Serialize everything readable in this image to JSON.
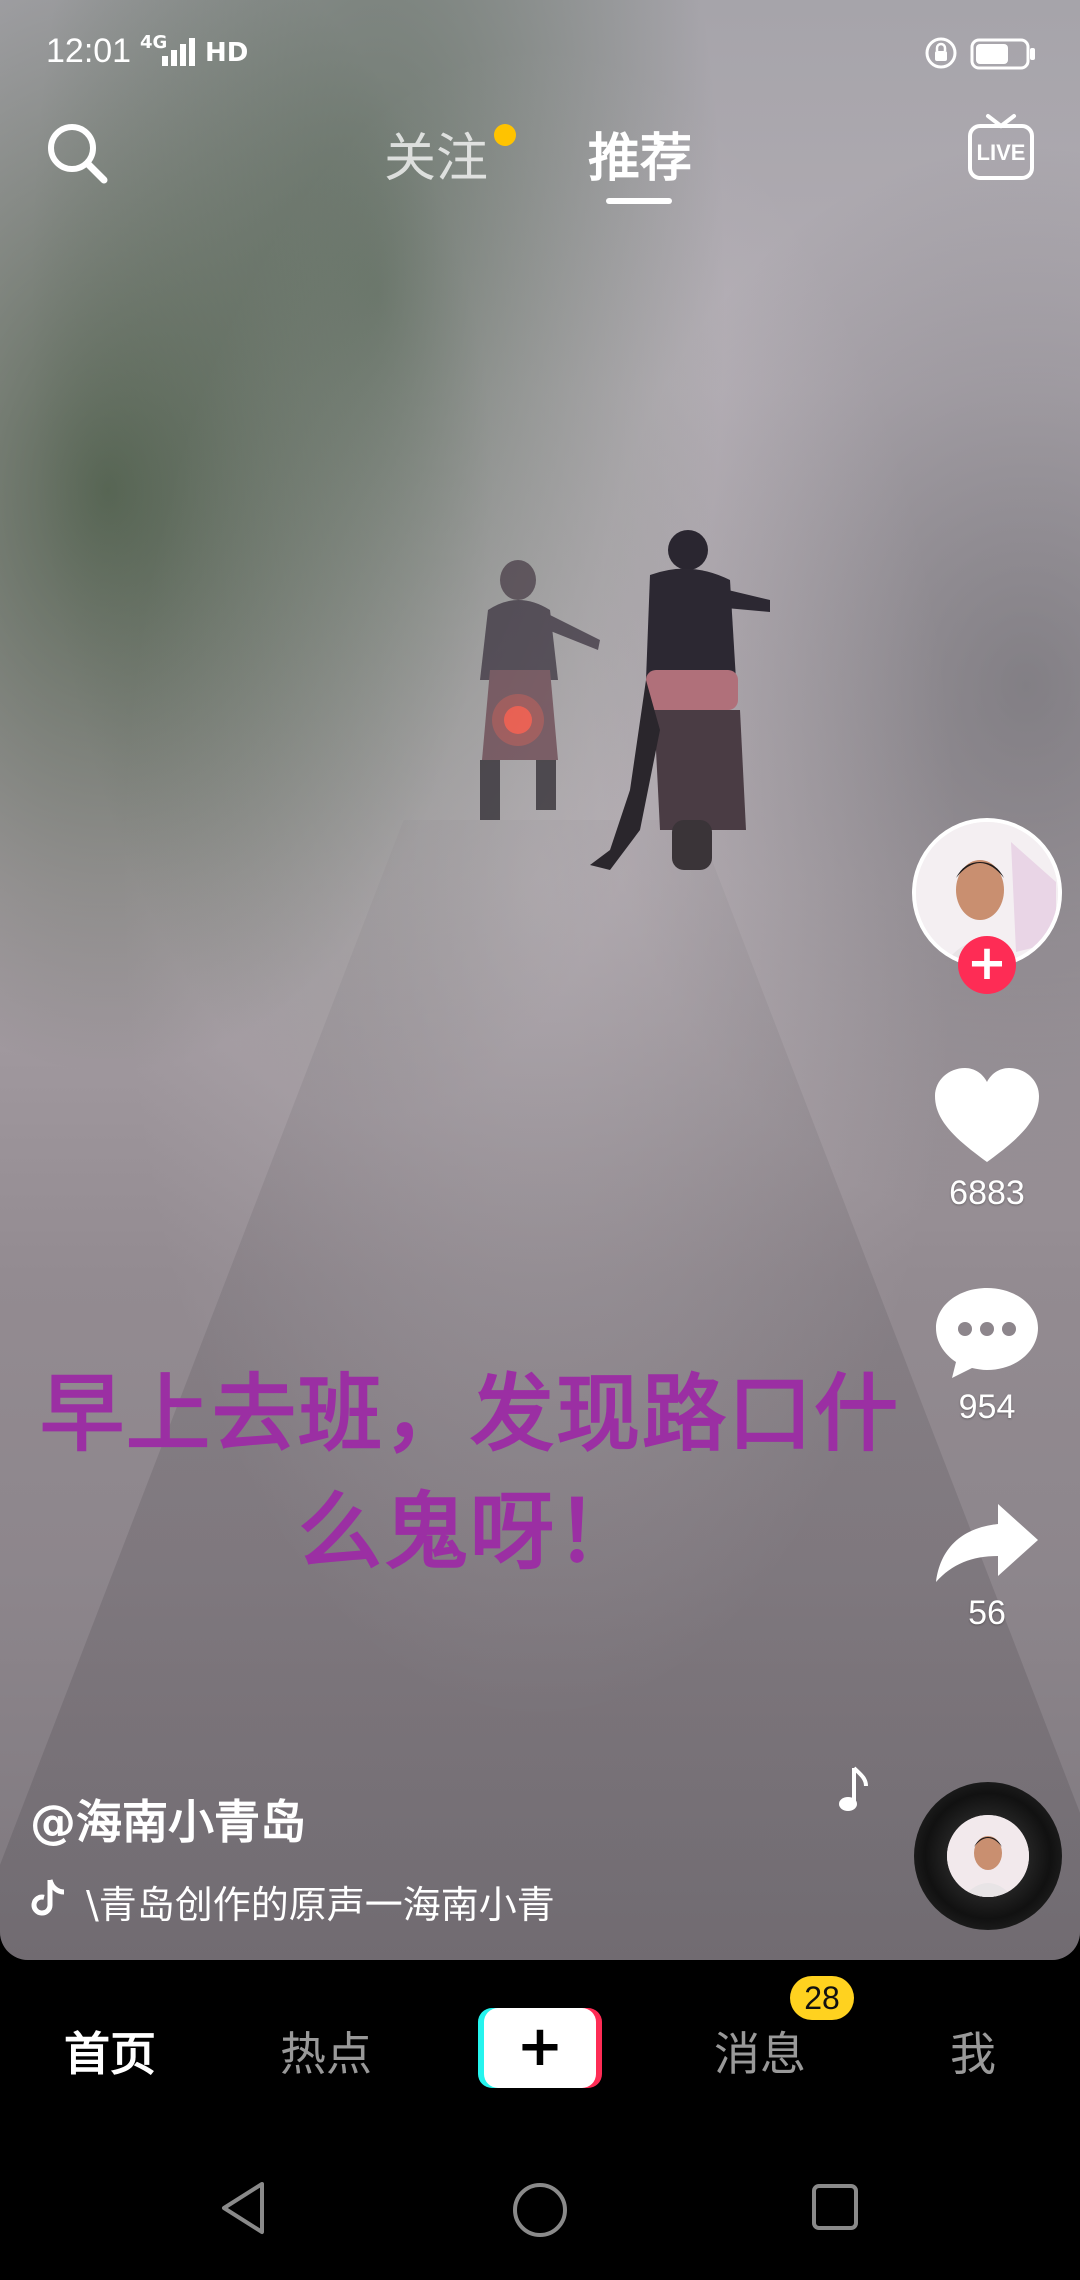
{
  "status_bar": {
    "time": "12:01",
    "network": "4G",
    "hd": "HD"
  },
  "top_nav": {
    "tabs": [
      {
        "label": "关注",
        "has_dot": true
      },
      {
        "label": "推荐",
        "active": true
      }
    ],
    "live_label": "LIVE"
  },
  "video": {
    "caption_line1": "早上去班，发现路口什",
    "caption_line2": "么鬼呀！",
    "caption_color": "#9b2fa3"
  },
  "actions": {
    "likes": "6883",
    "comments": "954",
    "shares": "56"
  },
  "post": {
    "author": "@海南小青岛",
    "music": "\\青岛创作的原声一海南小青"
  },
  "bottom_nav": {
    "home": "首页",
    "hot": "热点",
    "create": "+",
    "messages": "消息",
    "messages_badge": "28",
    "me": "我"
  },
  "colors": {
    "accent_red": "#fe2c55",
    "accent_cyan": "#25f4ee",
    "badge_yellow": "#ffd21f"
  }
}
